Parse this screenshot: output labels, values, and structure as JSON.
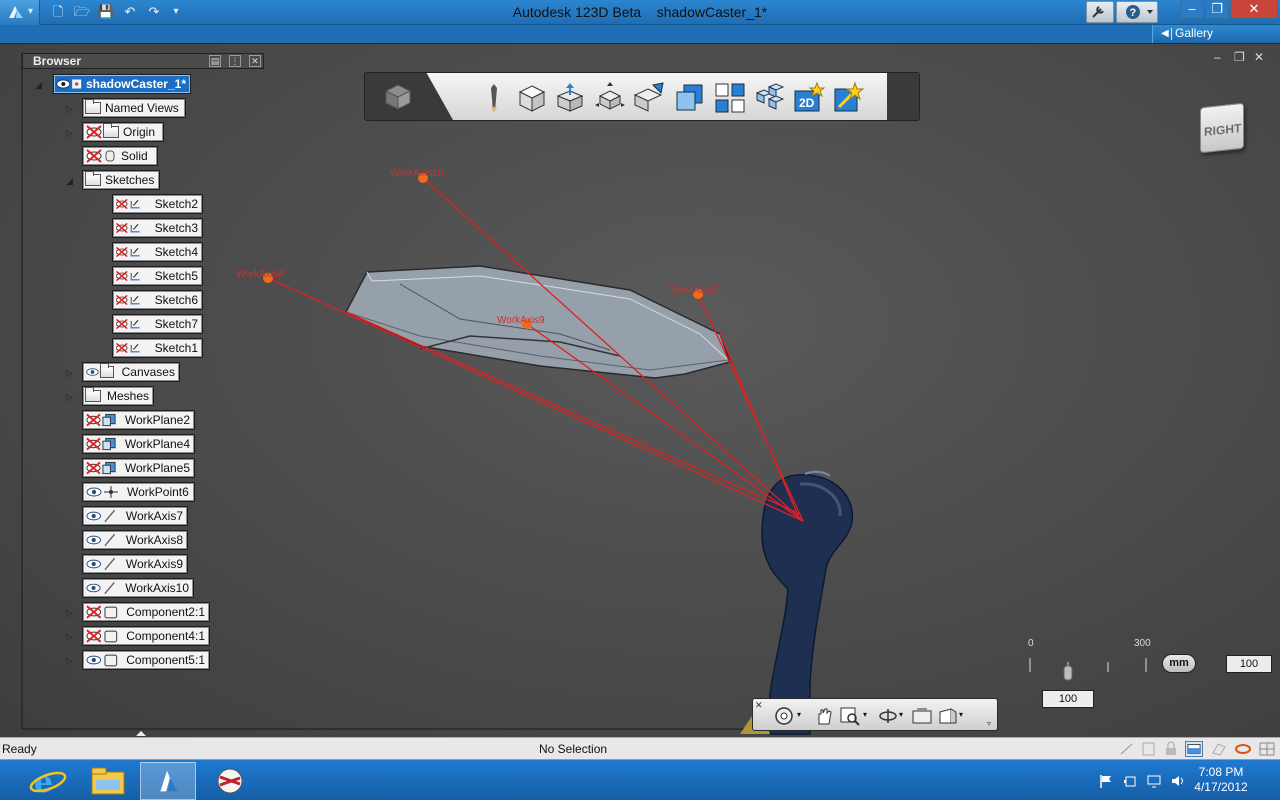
{
  "window": {
    "app_title": "Autodesk 123D Beta",
    "doc_title": "shadowCaster_1*"
  },
  "gallery": {
    "label": "Gallery"
  },
  "browser": {
    "title": "Browser",
    "root": "shadowCaster_1*",
    "items": [
      {
        "label": "Named Views"
      },
      {
        "label": "Origin"
      },
      {
        "label": "Solid"
      },
      {
        "label": "Sketches"
      },
      {
        "label": "Sketch2"
      },
      {
        "label": "Sketch3"
      },
      {
        "label": "Sketch4"
      },
      {
        "label": "Sketch5"
      },
      {
        "label": "Sketch6"
      },
      {
        "label": "Sketch7"
      },
      {
        "label": "Sketch1"
      },
      {
        "label": "Canvases"
      },
      {
        "label": "Meshes"
      },
      {
        "label": "WorkPlane2"
      },
      {
        "label": "WorkPlane4"
      },
      {
        "label": "WorkPlane5"
      },
      {
        "label": "WorkPoint6"
      },
      {
        "label": "WorkAxis7"
      },
      {
        "label": "WorkAxis8"
      },
      {
        "label": "WorkAxis9"
      },
      {
        "label": "WorkAxis10"
      },
      {
        "label": "Component2:1"
      },
      {
        "label": "Component4:1"
      },
      {
        "label": "Component5:1"
      }
    ]
  },
  "viewcube": {
    "face": "RIGHT"
  },
  "scene_labels": {
    "axis10": "WorkAxis10",
    "axis8": "WorkAxis8",
    "axis7": "WorkAxis7",
    "axis9": "WorkAxis9"
  },
  "scale": {
    "min": "0",
    "max": "300",
    "unit": "mm",
    "value": "100",
    "slider_value": "100"
  },
  "status": {
    "left": "Ready",
    "center": "No Selection"
  },
  "taskbar": {
    "time": "7:08 PM",
    "date": "4/17/2012"
  },
  "colors": {
    "titlebar": "#1f6db5",
    "viewport": "#4a4a4a",
    "selection": "#1b6ec2",
    "axis_red": "#e02020",
    "point_orange": "#f26a1b"
  }
}
